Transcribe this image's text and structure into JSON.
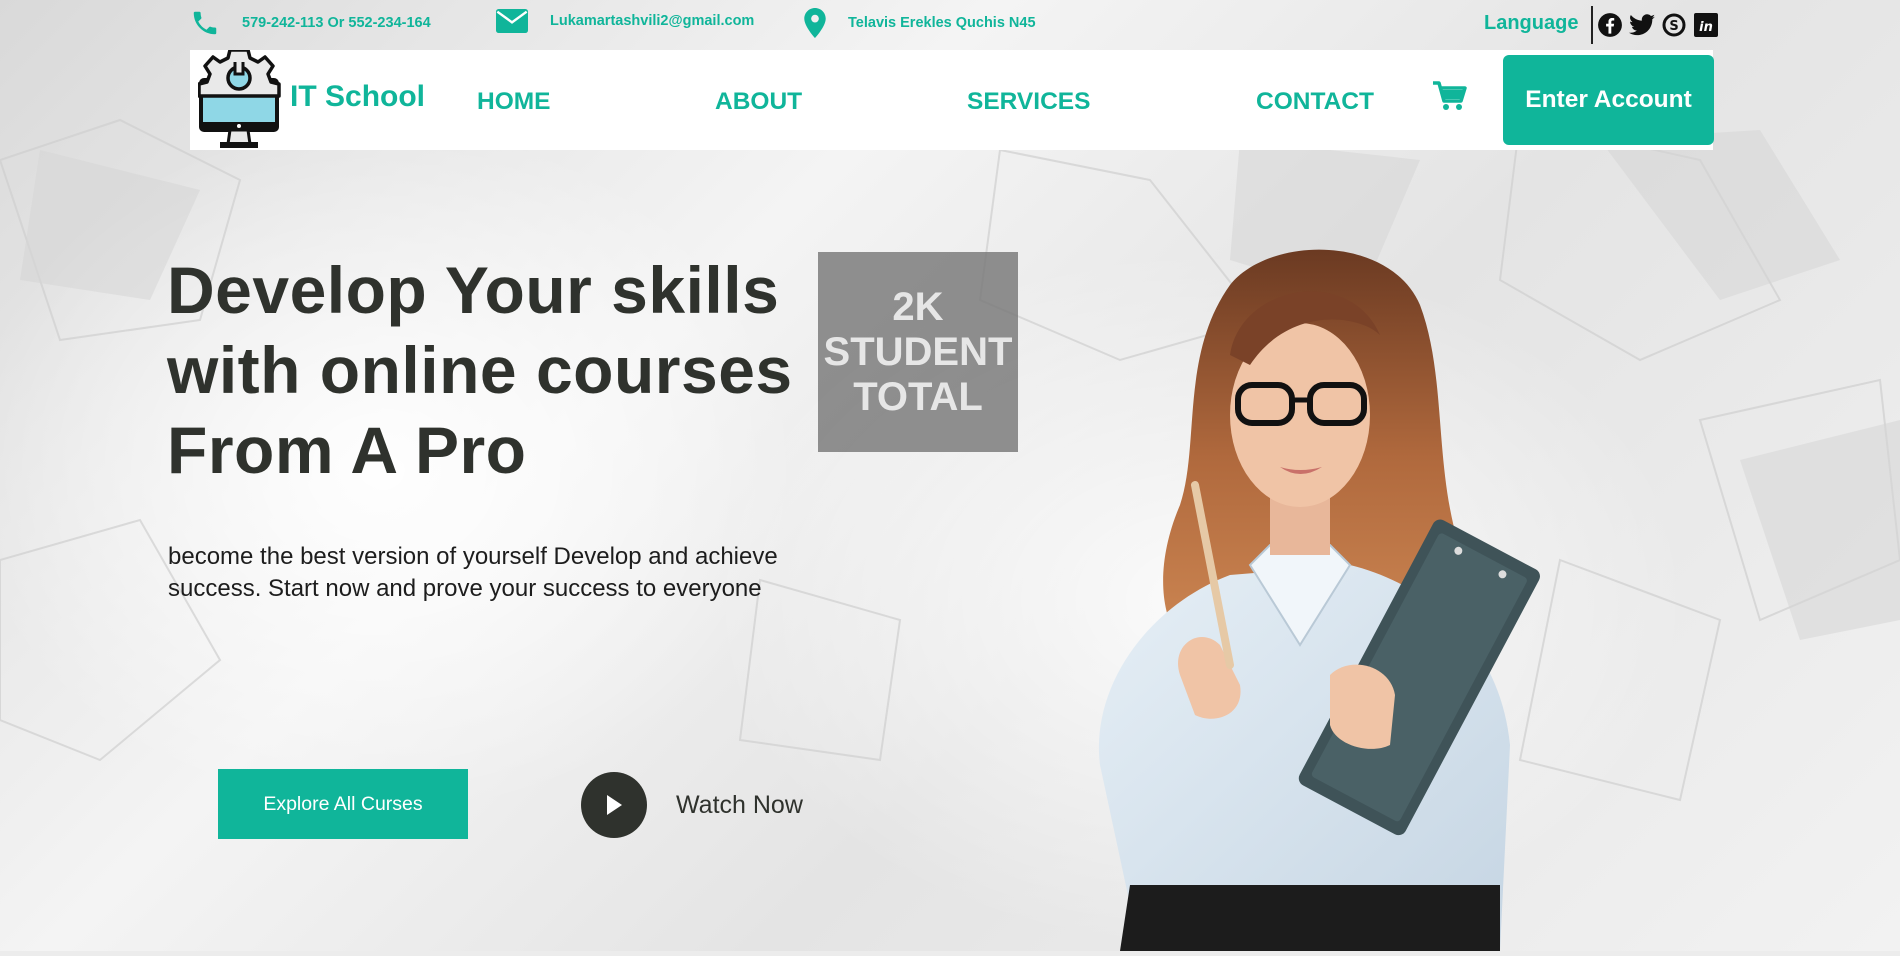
{
  "colors": {
    "accent": "#10b59a",
    "heading": "#2f322d",
    "stat_box": "#787878"
  },
  "topbar": {
    "phone": {
      "icon": "phone-icon",
      "text": "579-242-113 Or 552-234-164"
    },
    "email": {
      "icon": "envelope-icon",
      "text": "Lukamartashvili2@gmail.com"
    },
    "address": {
      "icon": "map-pin-icon",
      "text": "Telavis Erekles Quchis N45"
    },
    "language_label": "Language",
    "socials": [
      "facebook-icon",
      "twitter-icon",
      "skype-icon",
      "linkedin-icon"
    ]
  },
  "navbar": {
    "brand": "IT School",
    "logo_icon": "monitor-gear-icon",
    "links": [
      "HOME",
      "ABOUT",
      "SERVICES",
      "CONTACT"
    ],
    "cart_icon": "cart-icon",
    "cta_label": "Enter Account"
  },
  "hero": {
    "title_lines": [
      "Develop Your skills",
      "with online courses",
      "From A Pro"
    ],
    "stat_lines": [
      "2K",
      "STUDENT",
      "TOTAL"
    ],
    "subtitle": "become the best version of yourself Develop and achieve success. Start now and prove your success to everyone",
    "explore_label": "Explore All Curses",
    "play_icon": "play-icon",
    "watch_label": "Watch Now"
  }
}
